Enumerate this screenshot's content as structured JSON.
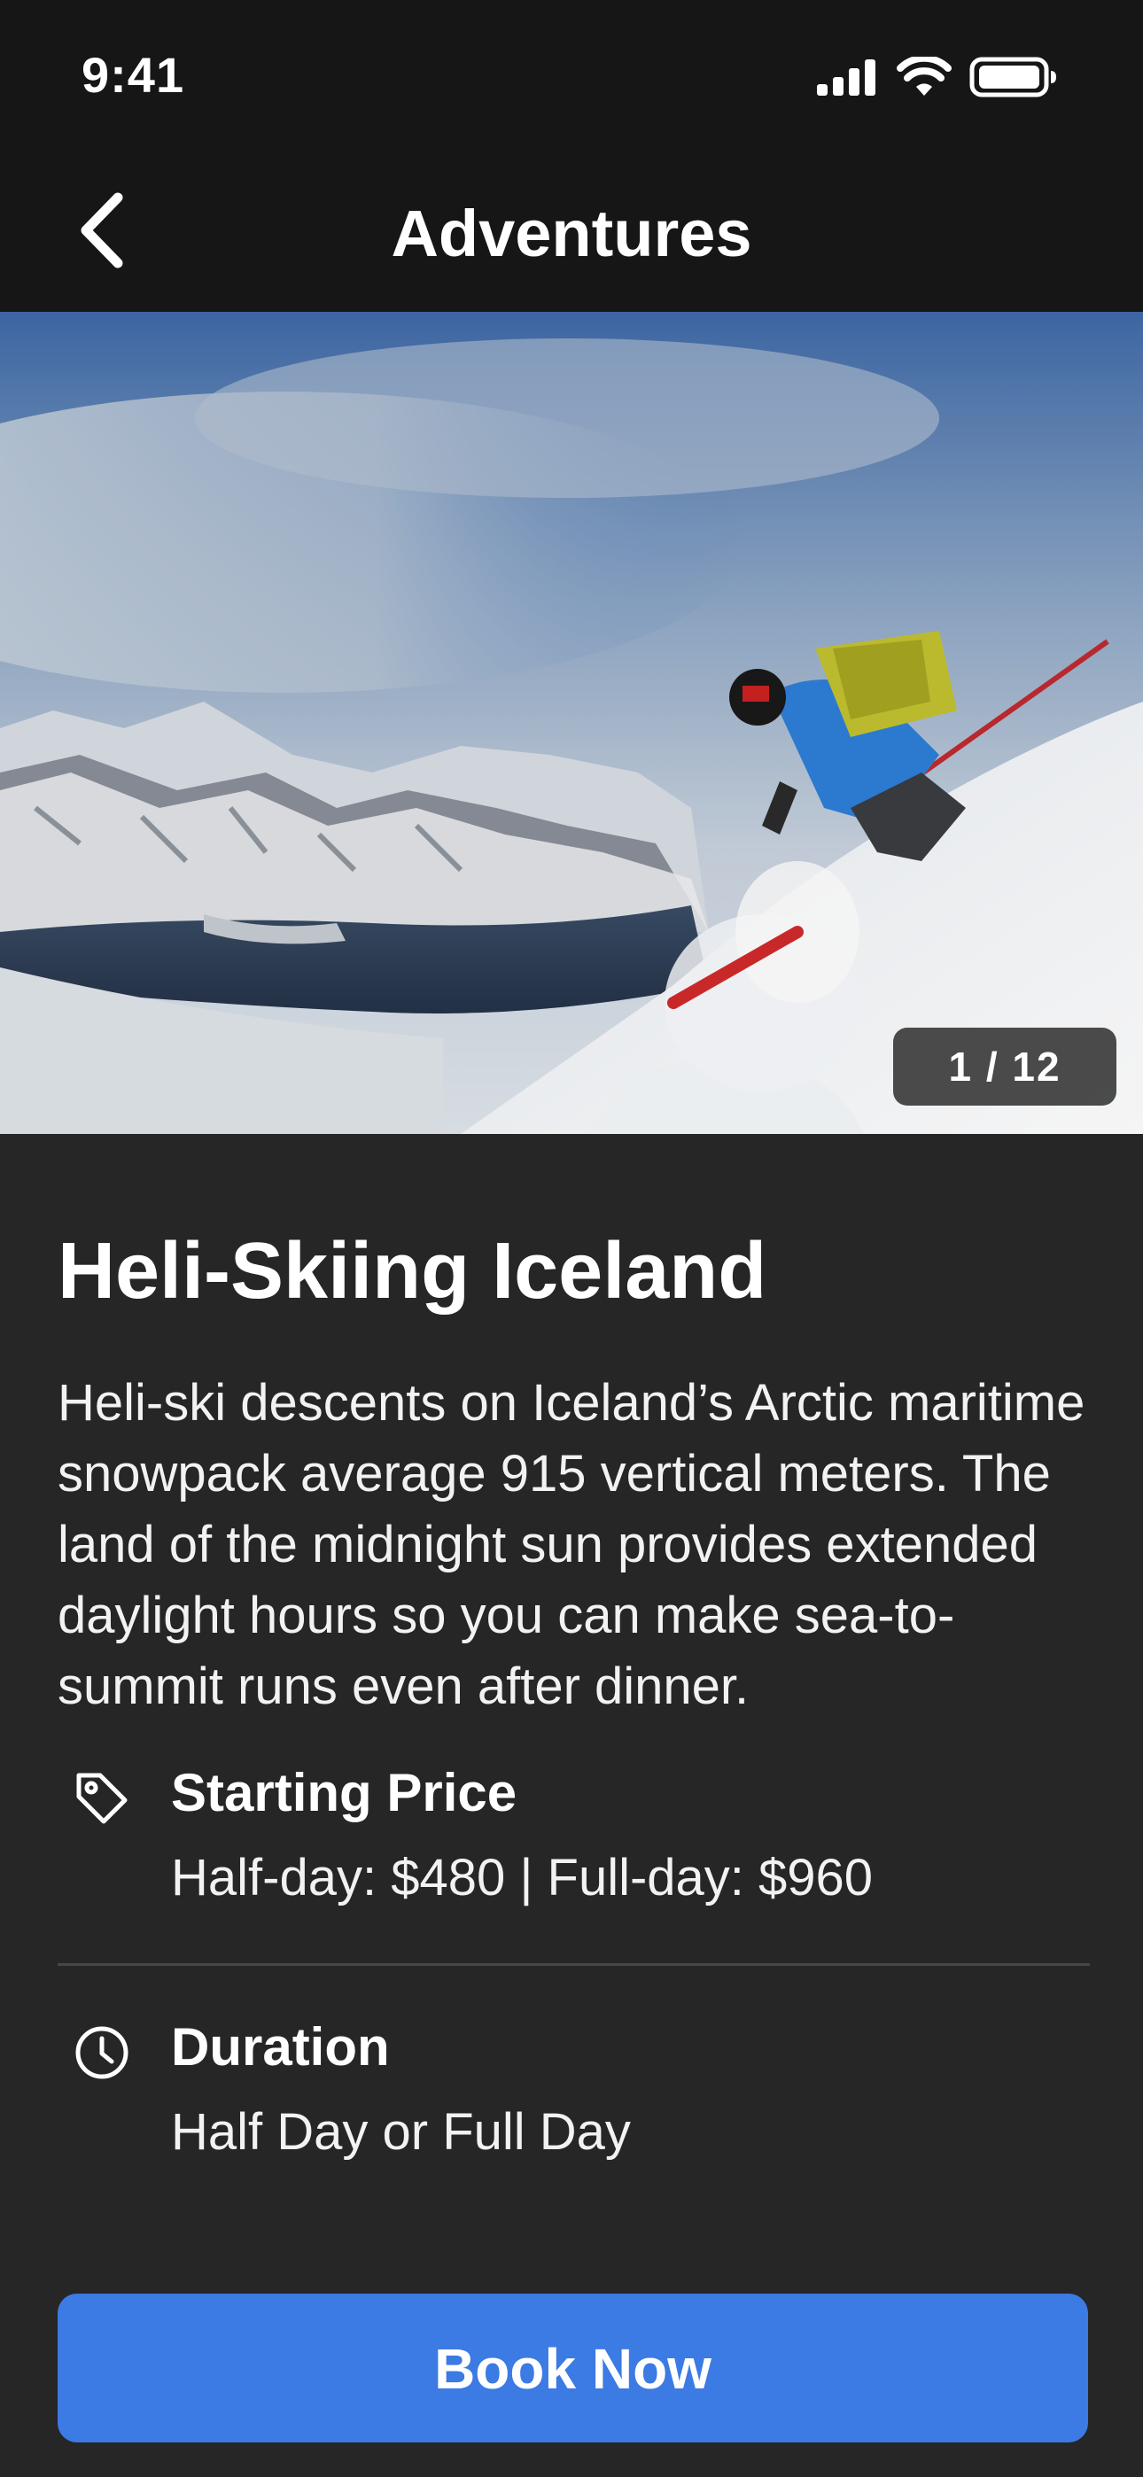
{
  "status_bar": {
    "time": "9:41",
    "icons": [
      "cellular-signal-icon",
      "wifi-icon",
      "battery-icon"
    ]
  },
  "nav": {
    "title": "Adventures",
    "back_icon": "chevron-left-icon"
  },
  "hero": {
    "image_description": "skier descending snowy slope above fjord",
    "counter": "1 / 12"
  },
  "adventure": {
    "title": "Heli-Skiing Iceland",
    "description": "Heli-ski descents on Iceland’s Arctic maritime snowpack average 915 vertical meters. The land of the midnight sun provides extended daylight hours so you can make sea-to-summit runs even after dinner."
  },
  "details": {
    "price": {
      "icon": "tag-icon",
      "label": "Starting Price",
      "value": "Half-day: $480 | Full-day: $960"
    },
    "duration": {
      "icon": "clock-icon",
      "label": "Duration",
      "value": "Half Day or Full Day"
    }
  },
  "actions": {
    "book_label": "Book Now"
  },
  "colors": {
    "background": "#262626",
    "header": "#161616",
    "accent": "#3c7ae4",
    "divider": "#474747"
  }
}
